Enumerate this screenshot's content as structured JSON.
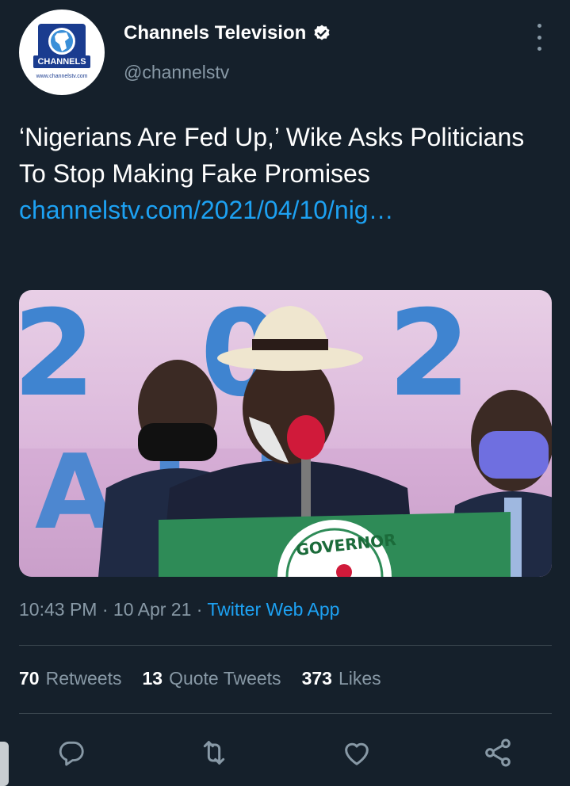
{
  "author": {
    "name": "Channels Television",
    "handle": "@channelstv",
    "avatar_brand": "CHANNELS",
    "avatar_url": "www.channelstv.com"
  },
  "tweet": {
    "text": "‘Nigerians Are Fed Up,’ Wike Asks Politicians To Stop Making Fake Promises ",
    "link": "channelstv.com/2021/04/10/nig…"
  },
  "media": {
    "backdrop_text": "2 0 2",
    "seal_text": "GOVERNOR"
  },
  "meta": {
    "time": "10:43 PM",
    "separator": " · ",
    "date": "10 Apr 21",
    "source": "Twitter Web App"
  },
  "stats": {
    "retweets_count": "70",
    "retweets_label": "Retweets",
    "quotes_count": "13",
    "quotes_label": "Quote Tweets",
    "likes_count": "373",
    "likes_label": "Likes"
  },
  "colors": {
    "background": "#15202b",
    "accent": "#1da1f2",
    "muted": "#8899a6",
    "divider": "#38444d"
  },
  "icons": [
    "verified-badge-icon",
    "more-icon",
    "reply-icon",
    "retweet-icon",
    "like-icon",
    "share-icon"
  ]
}
